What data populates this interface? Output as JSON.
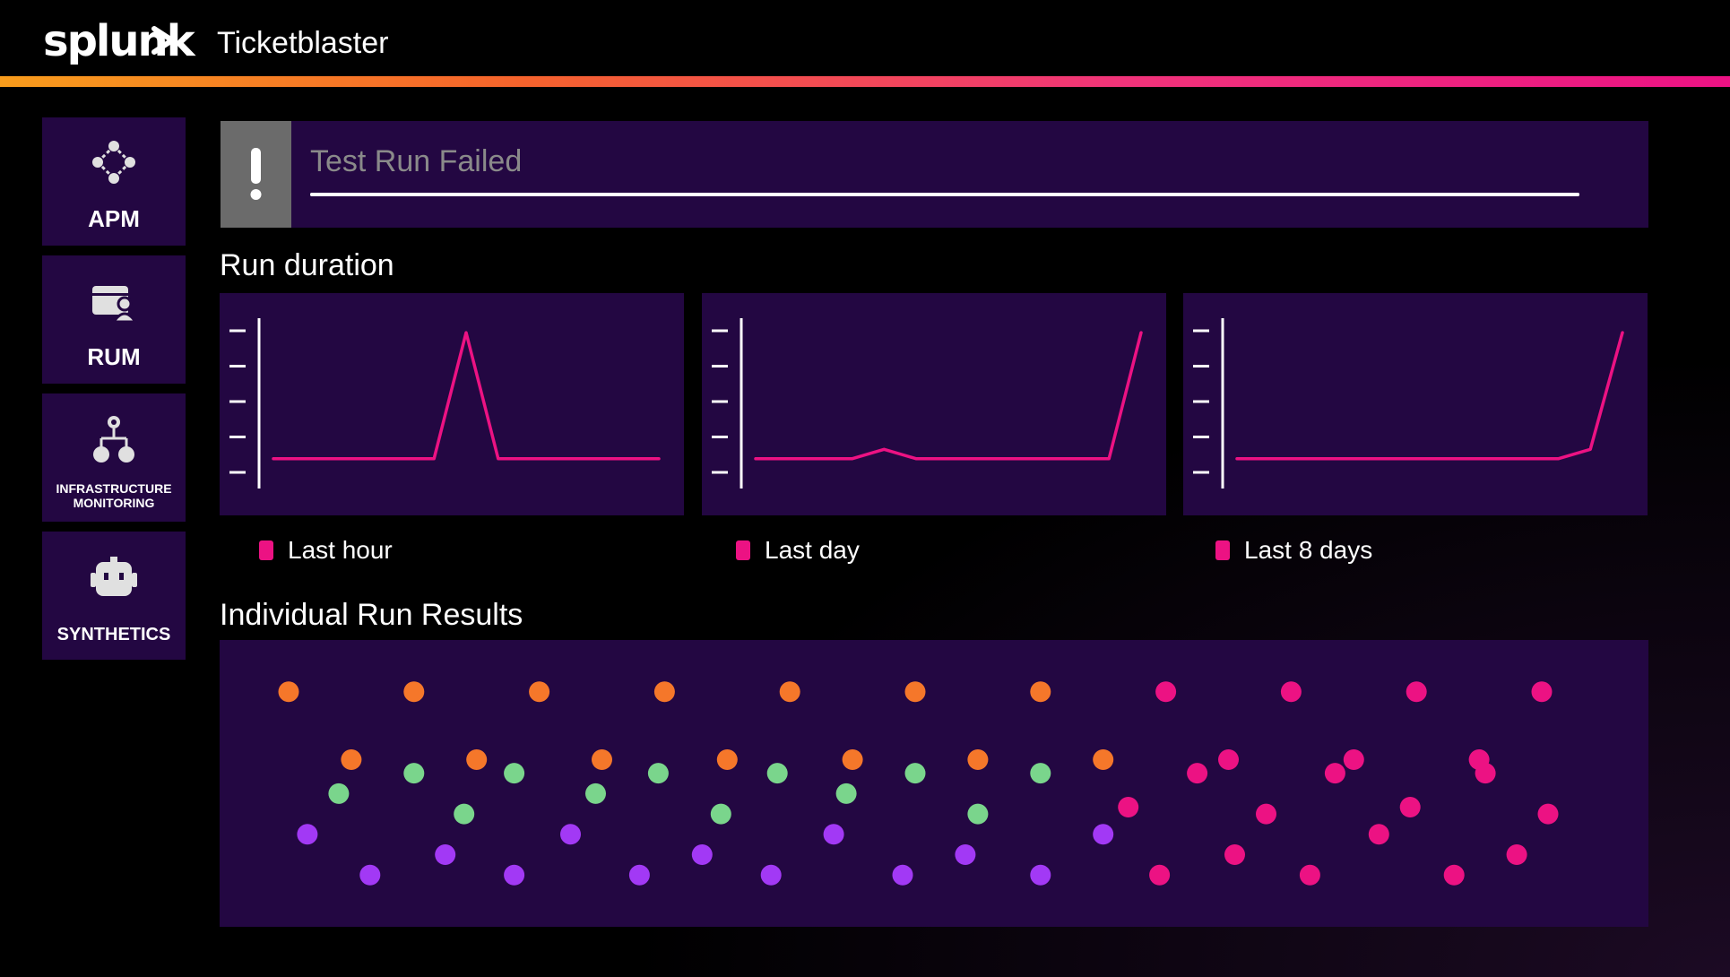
{
  "header": {
    "logo_text": "splunk",
    "app_title": "Ticketblaster",
    "accent_colors": [
      "#f89c1c",
      "#f0337a",
      "#ec1284"
    ]
  },
  "sidebar": {
    "items": [
      {
        "label": "APM",
        "icon": "apm-icon"
      },
      {
        "label": "RUM",
        "icon": "rum-icon"
      },
      {
        "label_line1": "INFRASTRUCTURE",
        "label_line2": "MONITORING",
        "icon": "infrastructure-icon"
      },
      {
        "label": "SYNTHETICS",
        "icon": "synthetics-icon"
      }
    ]
  },
  "alert": {
    "icon": "exclamation-icon",
    "title": "Test Run Failed",
    "progress": 1.0
  },
  "run_duration": {
    "title": "Run duration",
    "series_color": "#ec1283",
    "charts": [
      {
        "legend": "Last hour"
      },
      {
        "legend": "Last day"
      },
      {
        "legend": "Last 8 days"
      }
    ]
  },
  "run_results": {
    "title": "Individual Run Results",
    "colors": {
      "orange": "#f5772a",
      "pink": "#ec1283",
      "green": "#7ad58c",
      "purple": "#a239f5"
    }
  },
  "chart_data": [
    {
      "type": "line",
      "x": [
        0,
        1,
        2,
        3,
        4,
        5,
        6,
        7,
        8,
        9,
        10,
        11,
        12
      ],
      "series": [
        {
          "values": [
            1,
            1,
            1,
            1,
            1,
            1,
            5,
            1,
            1,
            1,
            1,
            1,
            1
          ]
        }
      ],
      "ylim": [
        0,
        5.4
      ]
    },
    {
      "type": "line",
      "x": [
        0,
        1,
        2,
        3,
        4,
        5,
        6,
        7,
        8,
        9,
        10,
        11,
        12
      ],
      "series": [
        {
          "values": [
            1,
            1,
            1,
            1,
            1.3,
            1,
            1,
            1,
            1,
            1,
            1,
            1,
            5
          ]
        }
      ],
      "ylim": [
        0,
        5.4
      ]
    },
    {
      "type": "line",
      "x": [
        0,
        1,
        2,
        3,
        4,
        5,
        6,
        7,
        8,
        9,
        10,
        11,
        12
      ],
      "series": [
        {
          "values": [
            1,
            1,
            1,
            1,
            1,
            1,
            1,
            1,
            1,
            1,
            1,
            1.3,
            5
          ]
        }
      ],
      "ylim": [
        0,
        5.4
      ]
    },
    {
      "type": "scatter",
      "note_series": "dot colors encode run status",
      "series": [
        {
          "name": "orange",
          "points": [
            [
              0,
              4
            ],
            [
              1,
              3
            ],
            [
              2,
              4
            ],
            [
              3,
              3
            ],
            [
              4,
              4
            ],
            [
              5,
              3
            ],
            [
              6,
              4
            ],
            [
              7,
              3
            ],
            [
              8,
              4
            ],
            [
              9,
              3
            ],
            [
              10,
              4
            ],
            [
              11,
              3
            ],
            [
              12,
              4
            ],
            [
              13,
              3
            ]
          ]
        },
        {
          "name": "pink",
          "points": [
            [
              14,
              4
            ],
            [
              15,
              3
            ],
            [
              16,
              4
            ],
            [
              17,
              3
            ],
            [
              18,
              4
            ],
            [
              19,
              3
            ],
            [
              20,
              4
            ]
          ]
        },
        {
          "name": "green",
          "points": [
            [
              0.8,
              2.5
            ],
            [
              2.0,
              2.8
            ],
            [
              2.8,
              2.2
            ],
            [
              3.6,
              2.8
            ],
            [
              4.9,
              2.5
            ],
            [
              5.9,
              2.8
            ],
            [
              6.9,
              2.2
            ],
            [
              7.8,
              2.8
            ],
            [
              8.9,
              2.5
            ],
            [
              10.0,
              2.8
            ],
            [
              11.0,
              2.2
            ],
            [
              12.0,
              2.8
            ]
          ]
        },
        {
          "name": "purple",
          "points": [
            [
              0.3,
              1.9
            ],
            [
              1.3,
              1.3
            ],
            [
              2.5,
              1.6
            ],
            [
              3.6,
              1.3
            ],
            [
              4.5,
              1.9
            ],
            [
              5.6,
              1.3
            ],
            [
              6.6,
              1.6
            ],
            [
              7.7,
              1.3
            ],
            [
              8.7,
              1.9
            ],
            [
              9.8,
              1.3
            ],
            [
              10.8,
              1.6
            ],
            [
              12.0,
              1.3
            ],
            [
              13.0,
              1.9
            ]
          ]
        },
        {
          "name": "pink-lower",
          "points": [
            [
              13.4,
              2.3
            ],
            [
              13.9,
              1.3
            ],
            [
              14.5,
              2.8
            ],
            [
              15.1,
              1.6
            ],
            [
              15.6,
              2.2
            ],
            [
              16.3,
              1.3
            ],
            [
              16.7,
              2.8
            ],
            [
              17.4,
              1.9
            ],
            [
              17.9,
              2.3
            ],
            [
              18.6,
              1.3
            ],
            [
              19.1,
              2.8
            ],
            [
              19.6,
              1.6
            ],
            [
              20.1,
              2.2
            ]
          ]
        }
      ],
      "xlim": [
        -0.5,
        20.5
      ],
      "ylim": [
        0.8,
        4.5
      ]
    }
  ]
}
